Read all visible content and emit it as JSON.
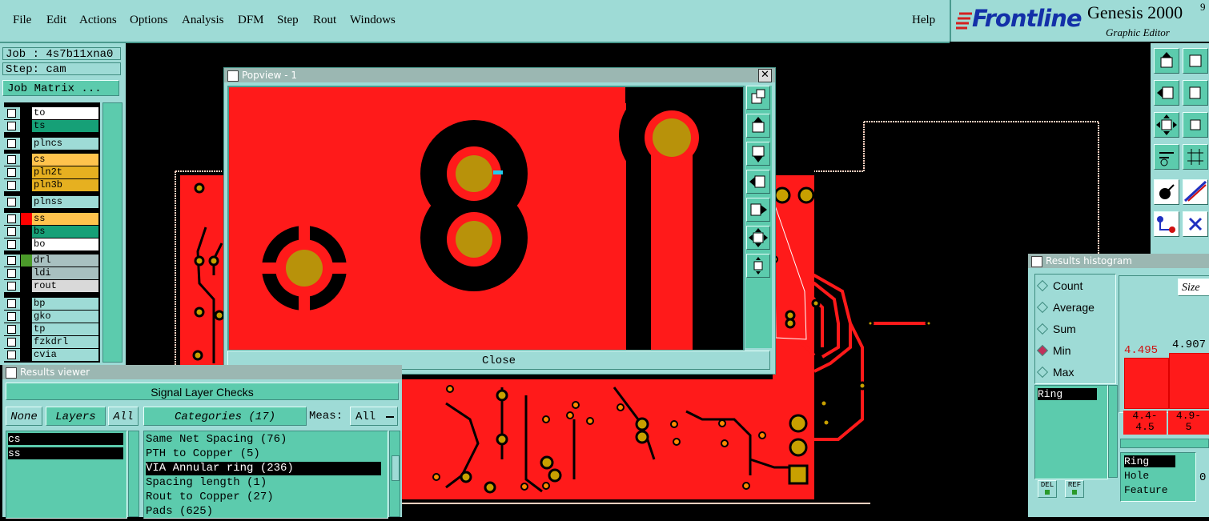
{
  "menu": {
    "items": [
      "File",
      "Edit",
      "Actions",
      "Options",
      "Analysis",
      "DFM",
      "Step",
      "Rout",
      "Windows"
    ],
    "help": "Help"
  },
  "brand": {
    "logo": "Frontline",
    "product": "Genesis 2000",
    "version": "9",
    "subtitle": "Graphic Editor"
  },
  "left": {
    "job": "Job : 4s7b11xna0",
    "step": "Step: cam",
    "job_matrix": "Job Matrix ...",
    "layers": [
      {
        "name": "to",
        "swatch": "#000000",
        "bg": "#ffffff"
      },
      {
        "name": "ts",
        "swatch": "#000000",
        "bg": "#16a077"
      },
      {
        "name": "plncs",
        "swatch": "#000000",
        "bg": "#9edbd6"
      },
      {
        "name": "cs",
        "swatch": "#000000",
        "bg": "#ffc34d"
      },
      {
        "name": "pln2t",
        "swatch": "#000000",
        "bg": "#e6b020"
      },
      {
        "name": "pln3b",
        "swatch": "#000000",
        "bg": "#e6b020"
      },
      {
        "name": "plnss",
        "swatch": "#000000",
        "bg": "#9edbd6"
      },
      {
        "name": "ss",
        "swatch": "#ff0000",
        "bg": "#ffc34d"
      },
      {
        "name": "bs",
        "swatch": "#000000",
        "bg": "#16a077"
      },
      {
        "name": "bo",
        "swatch": "#000000",
        "bg": "#ffffff"
      },
      {
        "name": "drl",
        "swatch": "#4b9a2a",
        "bg": "#a8c0c0"
      },
      {
        "name": "ldi",
        "swatch": "#000000",
        "bg": "#a8c0c0"
      },
      {
        "name": "rout",
        "swatch": "#000000",
        "bg": "#d9d9d9"
      },
      {
        "name": "bp",
        "swatch": "#000000",
        "bg": "#9edbd6"
      },
      {
        "name": "gko",
        "swatch": "#000000",
        "bg": "#9edbd6"
      },
      {
        "name": "tp",
        "swatch": "#000000",
        "bg": "#9edbd6"
      },
      {
        "name": "fzkdrl",
        "swatch": "#000000",
        "bg": "#9edbd6"
      },
      {
        "name": "cvia",
        "swatch": "#000000",
        "bg": "#9edbd6"
      }
    ]
  },
  "popview": {
    "title": "Popview - 1",
    "close": "Close"
  },
  "results_viewer": {
    "title": "Results viewer",
    "header": "Signal Layer Checks",
    "none_btn": "None",
    "layers_btn": "Layers",
    "all_btn": "All",
    "categories_btn": "Categories (17)",
    "meas_label": "Meas:",
    "meas_value": "All",
    "layer_items": [
      "cs",
      "ss"
    ],
    "categories": [
      "Same Net Spacing (76)",
      "PTH to Copper (5)",
      "VIA Annular ring (236)",
      "Spacing length (1)",
      "Rout to Copper (27)",
      "Pads (625)"
    ],
    "selected_category": 2
  },
  "histogram": {
    "title": "Results histogram",
    "options": [
      "Count",
      "Average",
      "Sum",
      "Min",
      "Max"
    ],
    "selected_option": "Min",
    "list_item": "Ring",
    "size_label": "Size",
    "bars": [
      {
        "value": "4.495",
        "range": "4.4-\n4.5"
      },
      {
        "value": "4.907",
        "range": "4.9-\n5"
      }
    ],
    "fields": [
      "Ring",
      "Hole",
      "Feature"
    ],
    "del_btn": "DEL",
    "ref_btn": "REF",
    "trailing_digit": "0"
  },
  "colors": {
    "panel": "#9edbd6",
    "teal": "#5ccbad",
    "board": "#ff1a1a",
    "copper": "#b8920a"
  }
}
